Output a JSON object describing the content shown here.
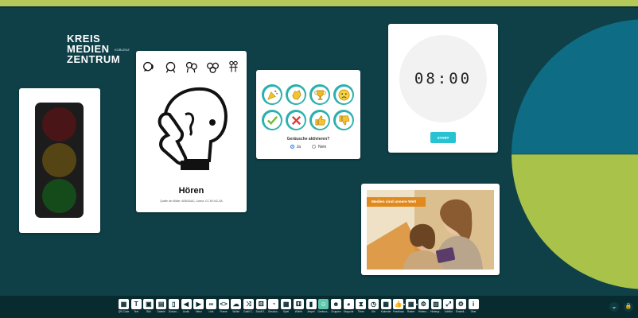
{
  "logo": {
    "line1": "KREIS",
    "line2": "MEDIEN",
    "line3": "ZENTRUM",
    "sub": "KOBLENZ"
  },
  "pictogram": {
    "word": "Hören",
    "source": "Quelle der Bilder: ARASAAC, Lizenz: CC BY-NC-SA",
    "small_icons": [
      "listen-icon",
      "think-icon",
      "talk-icon",
      "group-icon",
      "people-icon"
    ],
    "big_icon": "hear-icon"
  },
  "sounds": {
    "buttons": [
      "party-horn-icon",
      "clap-icon",
      "trophy-icon",
      "sad-face-icon",
      "check-icon",
      "cross-icon",
      "thumb-up-icon",
      "thumb-down-icon"
    ],
    "question": "Geräusche aktivieren?",
    "yes": "Ja",
    "no": "Nein",
    "selected": "Ja"
  },
  "timer": {
    "display": "08:00",
    "start": "START"
  },
  "media": {
    "banner": "Medien sind unsere Welt"
  },
  "toolbar": {
    "items": [
      {
        "label": "QR-Code",
        "icon": "qr-icon",
        "glyph": "▦"
      },
      {
        "label": "Text",
        "icon": "text-icon",
        "glyph": "T"
      },
      {
        "label": "Bild",
        "icon": "image-icon",
        "glyph": "▣"
      },
      {
        "label": "Galerie",
        "icon": "gallery-icon",
        "glyph": "▤"
      },
      {
        "label": "Dokum...",
        "icon": "document-icon",
        "glyph": "▯"
      },
      {
        "label": "Audio",
        "icon": "audio-icon",
        "glyph": "◀"
      },
      {
        "label": "Video",
        "icon": "video-icon",
        "glyph": "▶"
      },
      {
        "label": "Link",
        "icon": "link-icon",
        "glyph": "∞"
      },
      {
        "label": "Frame",
        "icon": "frame-icon",
        "glyph": "<>"
      },
      {
        "label": "Wolke",
        "icon": "cloud-icon",
        "glyph": "☁"
      },
      {
        "label": "Zufall Z...",
        "icon": "shuffle-icon",
        "glyph": "⤨"
      },
      {
        "label": "Zufall E...",
        "icon": "random-icon",
        "glyph": "⚄"
      },
      {
        "label": "Geschw...",
        "icon": "stopwatch-icon",
        "glyph": "◔"
      },
      {
        "label": "Spiel",
        "icon": "grid-icon",
        "glyph": "▦"
      },
      {
        "label": "Würfel",
        "icon": "dice-icon",
        "glyph": "⚅"
      },
      {
        "label": "Ampel",
        "icon": "traffic-light-icon",
        "glyph": "▮"
      },
      {
        "label": "Geräusc...",
        "icon": "sound-icon",
        "glyph": "☺"
      },
      {
        "label": "Gruppen",
        "icon": "groups-icon",
        "glyph": "☻"
      },
      {
        "label": "Stoppuhr",
        "icon": "timer-icon",
        "glyph": "◕"
      },
      {
        "label": "Timer",
        "icon": "hourglass-icon",
        "glyph": "⧗"
      },
      {
        "label": "Uhr",
        "icon": "clock-icon",
        "glyph": "◷"
      },
      {
        "label": "Kalender",
        "icon": "calendar-icon",
        "glyph": "▦"
      },
      {
        "label": "Feedback",
        "icon": "thumb-icon",
        "glyph": "👍"
      },
      {
        "label": "Raster",
        "icon": "raster-icon",
        "glyph": "▦"
      },
      {
        "label": "Hintern...",
        "icon": "settings-icon",
        "glyph": "⚙"
      },
      {
        "label": "Hintergr...",
        "icon": "picture-icon",
        "glyph": "▨"
      },
      {
        "label": "Vollbild",
        "icon": "fullscreen-icon",
        "glyph": "⤢"
      },
      {
        "label": "Einstell...",
        "icon": "gear-icon",
        "glyph": "⚙"
      },
      {
        "label": "Über",
        "icon": "info-icon",
        "glyph": "i"
      }
    ],
    "active_index": 16
  },
  "corner": {
    "collapse_glyph": "⌄",
    "lock_glyph": "🔒"
  }
}
